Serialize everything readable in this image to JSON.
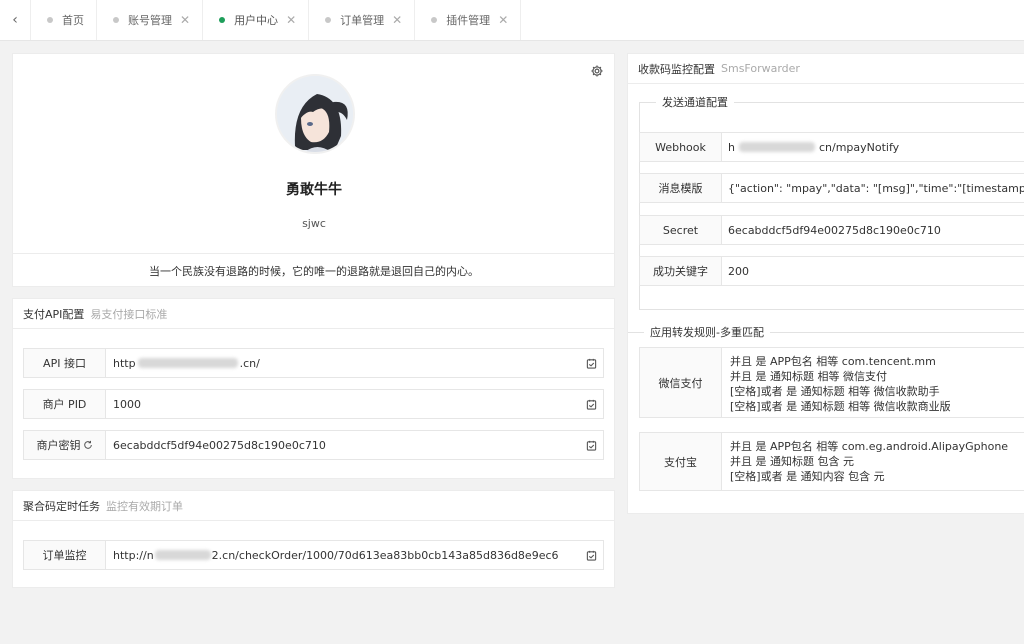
{
  "tabs": [
    {
      "label": "首页",
      "active": false,
      "closable": false
    },
    {
      "label": "账号管理",
      "active": false,
      "closable": true
    },
    {
      "label": "用户中心",
      "active": true,
      "closable": true
    },
    {
      "label": "订单管理",
      "active": false,
      "closable": true
    },
    {
      "label": "插件管理",
      "active": false,
      "closable": true
    }
  ],
  "close_glyph": "✕",
  "back_glyph": "‹",
  "accent": "#1e9e5a",
  "profile": {
    "name": "勇敢牛牛",
    "login": "sjwc",
    "motto": "当一个民族没有退路的时候，它的唯一的退路就是退回自己的内心。"
  },
  "pay_api": {
    "title": "支付API配置",
    "subtitle": "易支付接口标准",
    "api_label": "API 接口",
    "api_value_start": "http",
    "api_value_end": ".cn/",
    "pid_label": "商户 PID",
    "pid_value": "1000",
    "key_label": "商户密钥",
    "key_value": "6ecabddcf5df94e00275d8c190e0c710"
  },
  "cron": {
    "title": "聚合码定时任务",
    "subtitle": "监控有效期订单",
    "label": "订单监控",
    "value_start": "http://n",
    "value_end": "2.cn/checkOrder/1000/70d613ea83bb0cb143a85d836d8e9ec6"
  },
  "monitor": {
    "title": "收款码监控配置",
    "subtitle": "SmsForwarder",
    "send_legend": "发送通道配置",
    "webhook_label": "Webhook",
    "webhook_value_start": "h",
    "webhook_value_end": "cn/mpayNotify",
    "template_label": "消息模版",
    "template_value": "{\"action\": \"mpay\",\"data\": \"[msg]\",\"time\":\"[timestamp]\",\"sign\": \"[s",
    "secret_label": "Secret",
    "secret_value": "6ecabddcf5df94e00275d8c190e0c710",
    "success_label": "成功关键字",
    "success_value": "200",
    "rules_legend": "应用转发规则-多重匹配",
    "wechat_label": "微信支付",
    "wechat_rules": [
      "并且 是 APP包名 相等 com.tencent.mm",
      "并且 是 通知标题 相等 微信支付",
      "[空格]或者 是 通知标题 相等 微信收款助手",
      "[空格]或者 是 通知标题 相等 微信收款商业版"
    ],
    "alipay_label": "支付宝",
    "alipay_rules": [
      "并且 是 APP包名 相等 com.eg.android.AlipayGphone",
      "并且 是 通知标题 包含 元",
      "[空格]或者 是 通知内容 包含 元"
    ]
  }
}
